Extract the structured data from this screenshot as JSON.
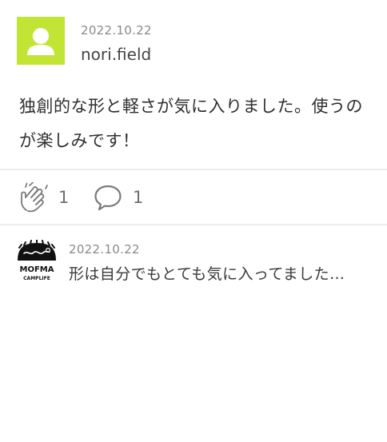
{
  "post": {
    "date": "2022.10.22",
    "username": "nori.field",
    "avatar_color": "#c2e535",
    "text": "独創的な形と軽さが気に入りました。使うのが楽しみです！"
  },
  "actions": {
    "clap_icon": "clap-icon",
    "clap_count": "1",
    "comment_icon": "speech-bubble-icon",
    "comment_count": "1"
  },
  "reply": {
    "date": "2022.10.22",
    "text": "形は自分でもとても気に入ってました…",
    "logo_text": "MOFMA",
    "logo_subtext": "CAMPLIFE"
  }
}
